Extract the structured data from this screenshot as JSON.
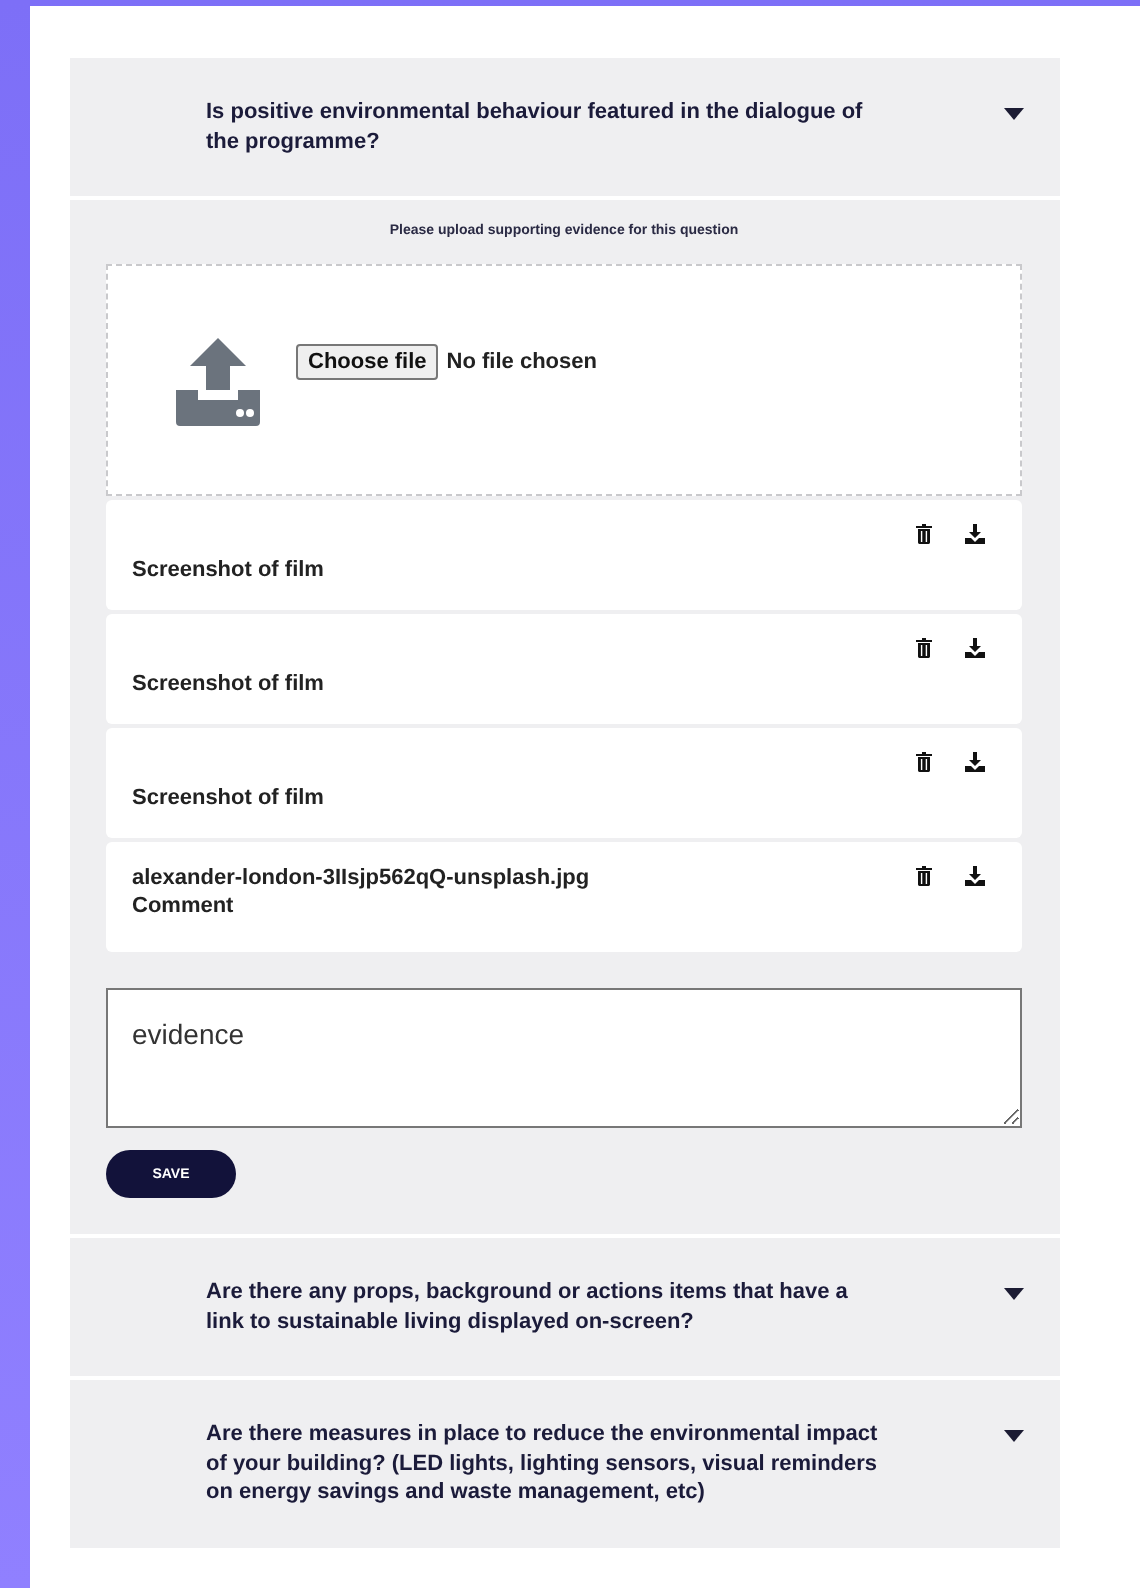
{
  "questions": [
    {
      "text": "Is positive environmental behaviour featured in the dialogue of the programme?",
      "answer": {
        "upload": {
          "prompt": "Please upload supporting evidence for this question",
          "button": "Choose file",
          "status": "No file chosen"
        },
        "files": [
          {
            "name": "Screenshot of film"
          },
          {
            "name": "Screenshot of film"
          },
          {
            "name": "Screenshot of film"
          },
          {
            "name": "alexander-london-3IIsjp562qQ-unsplash.jpg",
            "comment": "Comment"
          }
        ],
        "evidence": {
          "value": "evidence"
        },
        "save_button": "SAVE"
      }
    },
    {
      "text": "Are there any props, background or actions items that have a link to sustainable living displayed on-screen?"
    },
    {
      "text": "Are there measures in place to reduce the environmental impact of your building? (LED lights, lighting sensors, visual reminders on energy savings and waste management, etc)"
    }
  ]
}
